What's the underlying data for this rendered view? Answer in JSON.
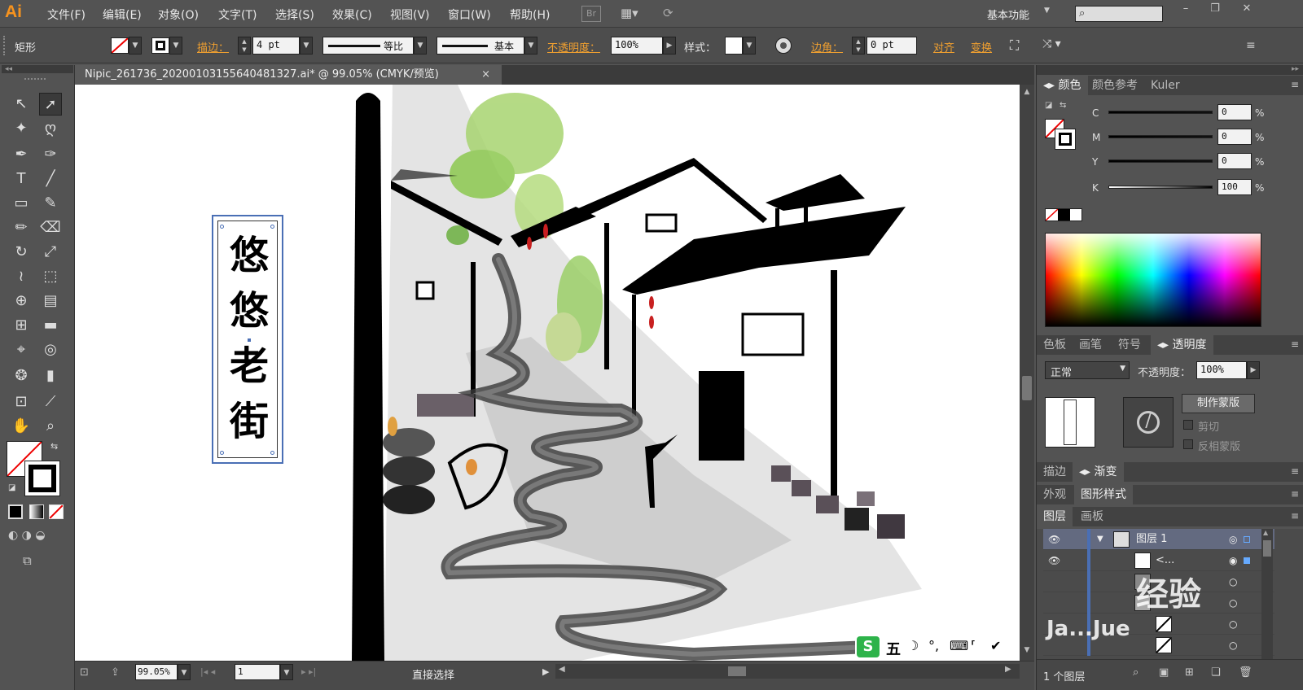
{
  "app": {
    "logo": "Ai",
    "workspace": "基本功能"
  },
  "menu": [
    "文件(F)",
    "编辑(E)",
    "对象(O)",
    "文字(T)",
    "选择(S)",
    "效果(C)",
    "视图(V)",
    "窗口(W)",
    "帮助(H)"
  ],
  "menu_extra": {
    "bridge": "Br"
  },
  "control": {
    "shape_label": "矩形",
    "stroke_label": "描边：",
    "stroke_value": "4 pt",
    "stroke_profile": "等比",
    "brush": "基本",
    "opacity_label": "不透明度：",
    "opacity_value": "100%",
    "style_label": "样式：",
    "corner_label": "边角：",
    "corner_value": "0 pt",
    "align_label": "对齐",
    "transform_label": "变换"
  },
  "document": {
    "tab_title": "Nipic_261736_20200103155640481327.ai* @ 99.05% (CMYK/预览)",
    "close": "×",
    "artwork_text": [
      "悠",
      "悠",
      "老",
      "街"
    ]
  },
  "ime": {
    "logo": "S",
    "label": "五"
  },
  "status": {
    "zoom": "99.05%",
    "artboard": "1",
    "tool": "直接选择"
  },
  "color_panel": {
    "tabs": [
      "颜色",
      "颜色参考",
      "Kuler"
    ],
    "channels": [
      {
        "name": "C",
        "value": "0",
        "unit": "%"
      },
      {
        "name": "M",
        "value": "0",
        "unit": "%"
      },
      {
        "name": "Y",
        "value": "0",
        "unit": "%"
      },
      {
        "name": "K",
        "value": "100",
        "unit": "%"
      }
    ]
  },
  "transparency_panel": {
    "tabs": [
      "色板",
      "画笔",
      "符号",
      "透明度"
    ],
    "blend_mode": "正常",
    "opacity_label": "不透明度：",
    "opacity_value": "100%",
    "make_mask": "制作蒙版",
    "clip": "剪切",
    "invert_mask": "反相蒙版"
  },
  "stroke_panel": {
    "tabs": [
      "描边",
      "渐变"
    ]
  },
  "appearance_panel": {
    "tabs": [
      "外观",
      "图形样式"
    ]
  },
  "layers_panel": {
    "tabs": [
      "图层",
      "画板"
    ],
    "rows": [
      {
        "name": "图层 1"
      },
      {
        "name": "<..."
      },
      {
        "name": ""
      },
      {
        "name": ""
      },
      {
        "name": ""
      },
      {
        "name": ""
      }
    ],
    "footer": "1 个图层"
  },
  "watermark": {
    "line1": "经验",
    "line2": "Ja...Jue"
  },
  "colors": {
    "accent_orange": "#f0a030",
    "panel_bg": "#535353",
    "selection_blue": "#4a6fb5"
  }
}
